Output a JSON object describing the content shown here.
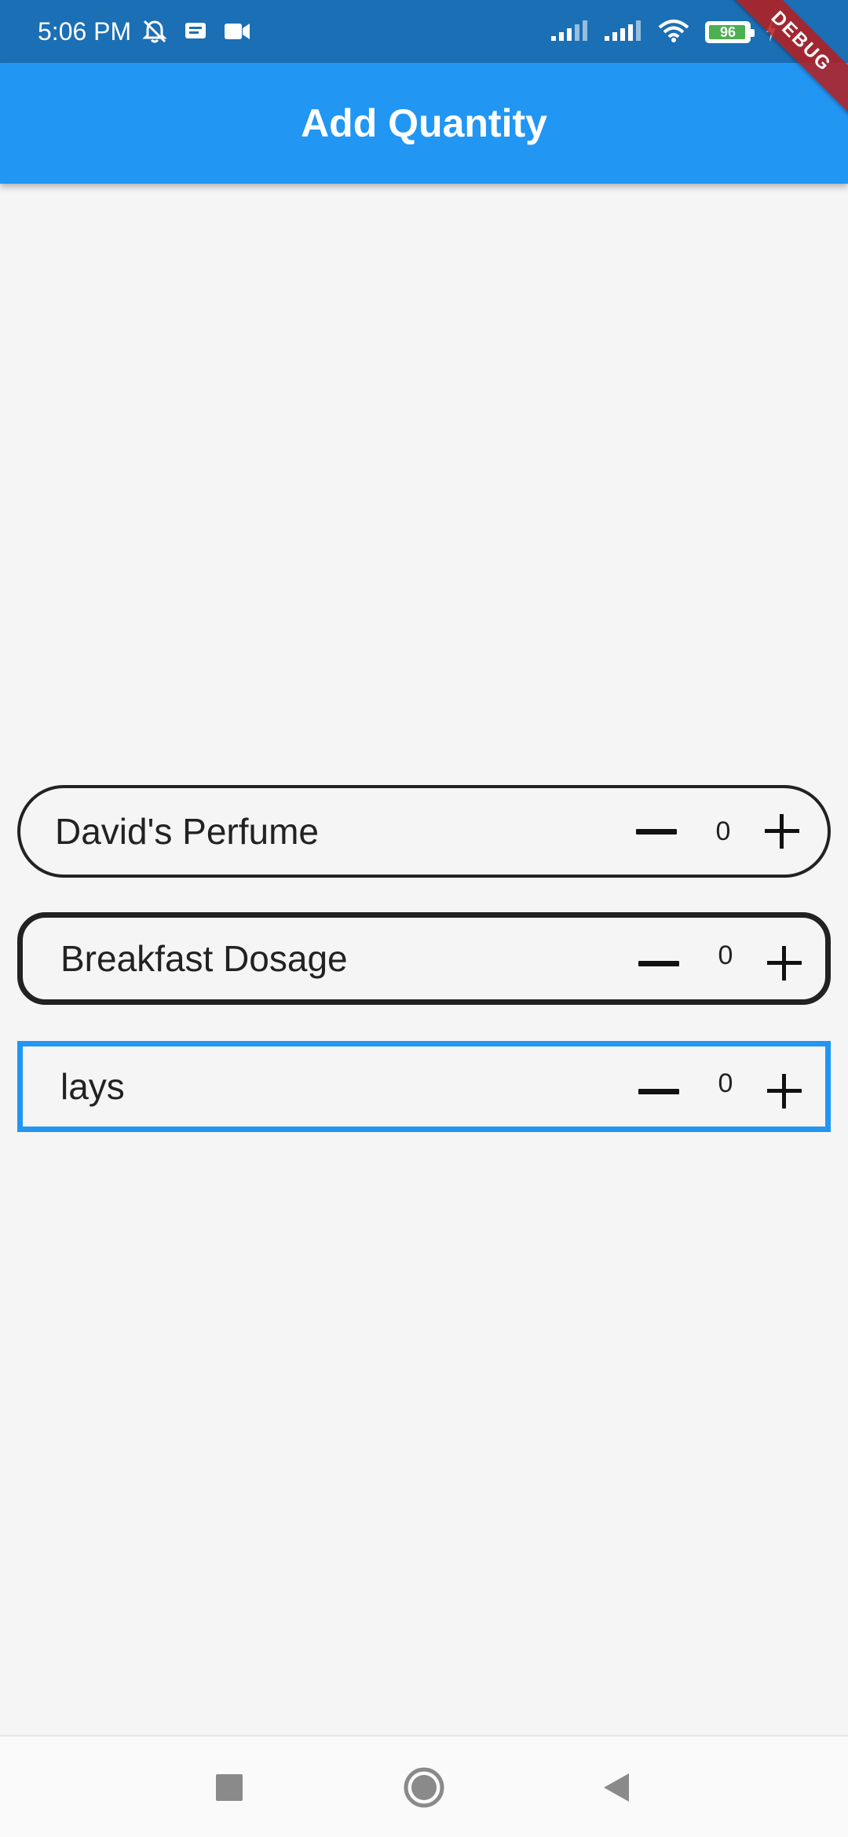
{
  "status_bar": {
    "time": "5:06 PM",
    "battery_level": "96",
    "battery_fraction": 0.96,
    "left_icons": [
      "alarm-off-icon",
      "message-icon",
      "video-camera-icon"
    ],
    "right_icons": [
      "signal-icon",
      "signal-icon",
      "wifi-icon",
      "battery-icon",
      "charging-bolt-icon"
    ],
    "color": "#1b6fb5"
  },
  "debug_banner": {
    "label": "DEBUG"
  },
  "app_bar": {
    "title": "Add Quantity",
    "color": "#2196f3"
  },
  "items": [
    {
      "name": "David's Perfume",
      "quantity": "0",
      "decrement_icon": "minus-icon",
      "increment_icon": "plus-icon",
      "border_color": "#222222",
      "style": "pill"
    },
    {
      "name": "Breakfast Dosage",
      "quantity": "0",
      "decrement_icon": "minus-icon",
      "increment_icon": "plus-icon",
      "border_color": "#222222",
      "style": "rounded"
    },
    {
      "name": "lays",
      "quantity": "0",
      "decrement_icon": "minus-icon",
      "increment_icon": "plus-icon",
      "border_color": "#2196f3",
      "style": "square"
    }
  ],
  "nav_bar": {
    "buttons": [
      "recents-icon",
      "home-icon",
      "back-icon"
    ]
  }
}
